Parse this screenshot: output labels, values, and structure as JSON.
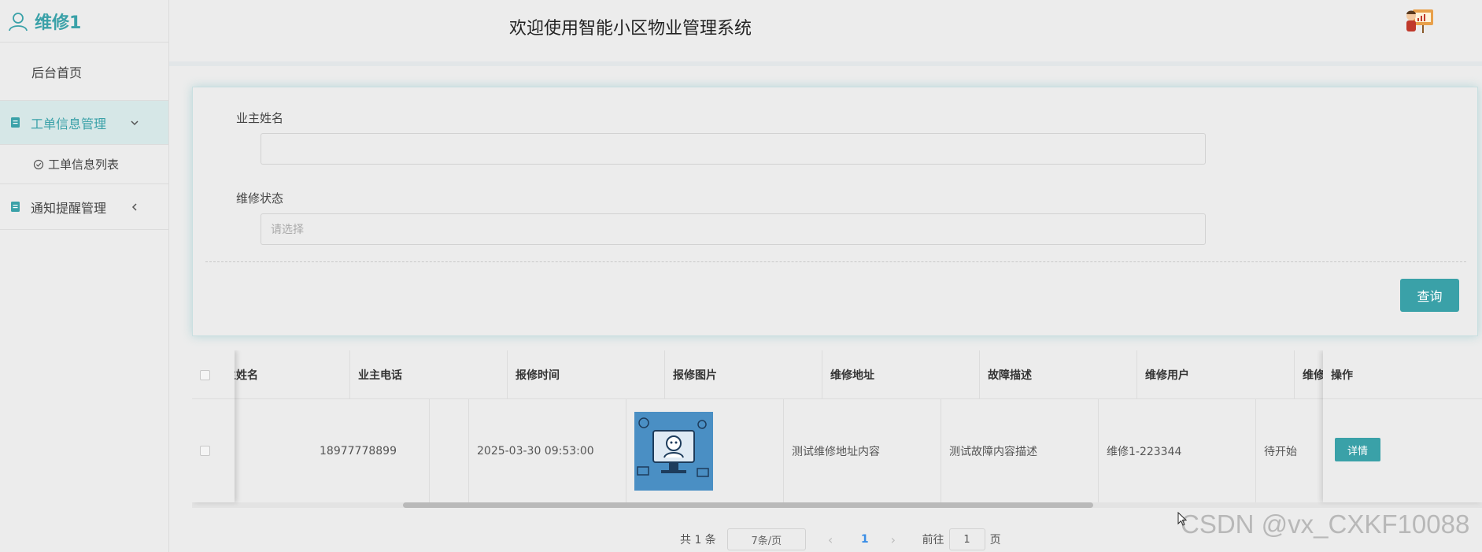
{
  "brand": {
    "name": "维修1"
  },
  "sidebar": {
    "home": "后台首页",
    "groups": [
      {
        "label": "工单信息管理",
        "expanded": true,
        "children": [
          "工单信息列表"
        ]
      },
      {
        "label": "通知提醒管理",
        "expanded": false,
        "children": []
      }
    ]
  },
  "header": {
    "title": "欢迎使用智能小区物业管理系统"
  },
  "search": {
    "owner_name_label": "业主姓名",
    "owner_name_value": "",
    "status_label": "维修状态",
    "status_placeholder": "请选择",
    "query_button": "查询"
  },
  "table": {
    "columns": [
      "主姓名",
      "业主电话",
      "报修时间",
      "报修图片",
      "维修地址",
      "故障描述",
      "维修用户",
      "维修",
      "操作"
    ],
    "rows": [
      {
        "phone": "18977778899",
        "time": "2025-03-30 09:53:00",
        "address": "测试维修地址内容",
        "fault": "测试故障内容描述",
        "repair_user": "维修1-223344",
        "status": "待开始",
        "action": "详情"
      }
    ]
  },
  "pagination": {
    "total": "共 1 条",
    "page_size": "7条/页",
    "current_page": "1",
    "goto_label": "前往",
    "goto_value": "1",
    "page_suffix": "页"
  },
  "watermark": "CSDN @vx_CXKF10088",
  "colors": {
    "accent": "#3aa1a8",
    "link": "#3a8ee6"
  }
}
